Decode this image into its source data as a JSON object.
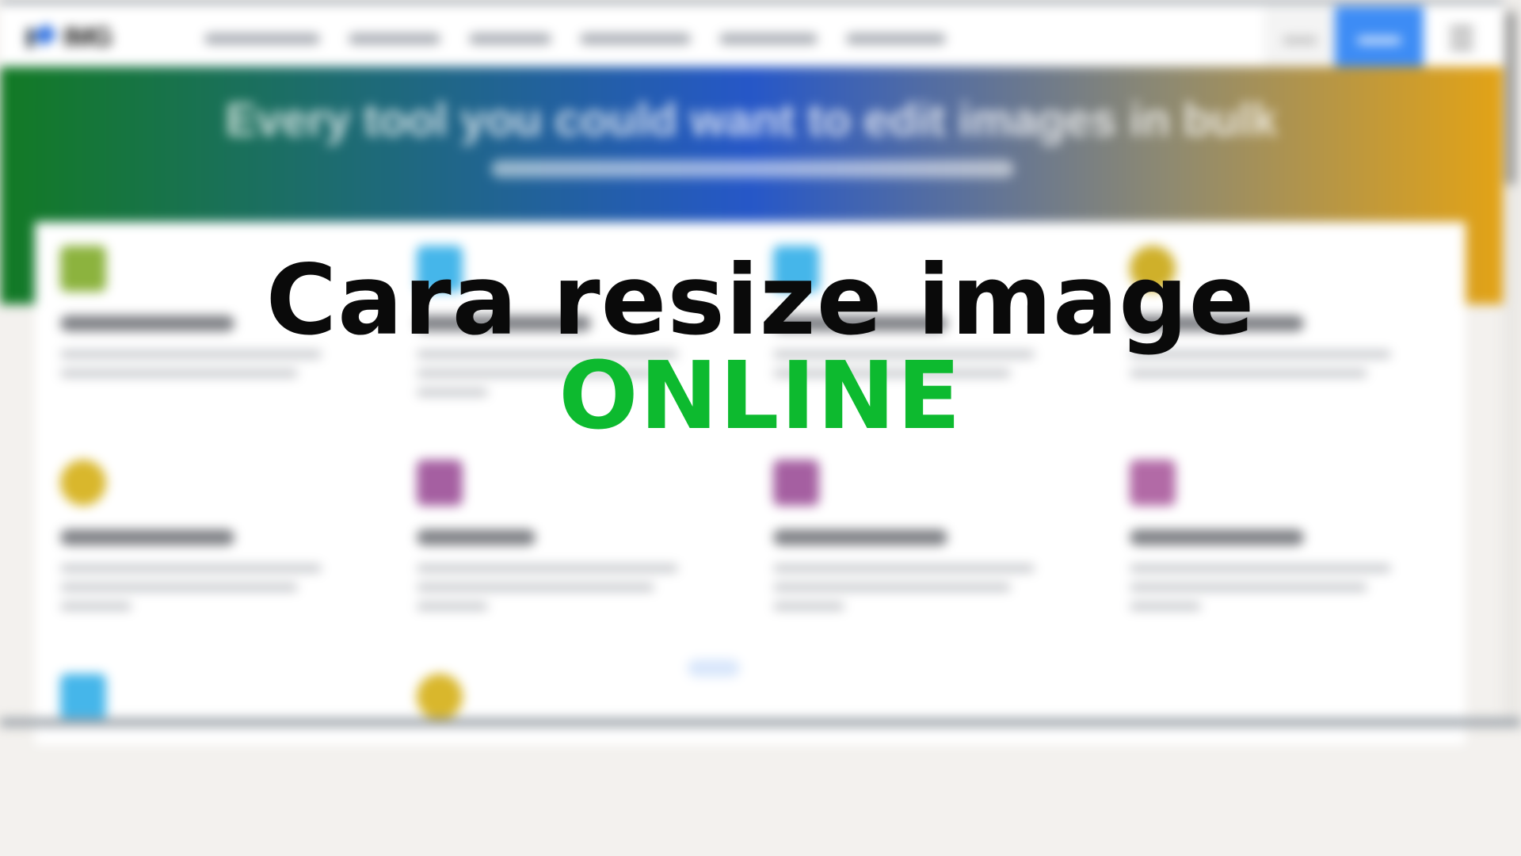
{
  "site": {
    "logo_text": "IMG",
    "hero_title": "Every tool you could want to edit images in bulk"
  },
  "overlay": {
    "title": "Cara resize image",
    "subtitle": "ONLINE",
    "title_color": "#0a0a0a",
    "subtitle_color": "#0dba2f"
  },
  "colors": {
    "hero_gradient": [
      "#127a24",
      "#2657c8",
      "#e3a315"
    ],
    "signup_button": "#3d8cf5"
  },
  "icons": [
    "compress-icon",
    "resize-icon",
    "crop-icon",
    "convert-to-jpg-icon",
    "convert-from-jpg-icon",
    "photo-editor-icon",
    "watermark-icon",
    "meme-icon",
    "upscale-icon",
    "convert-icon"
  ]
}
